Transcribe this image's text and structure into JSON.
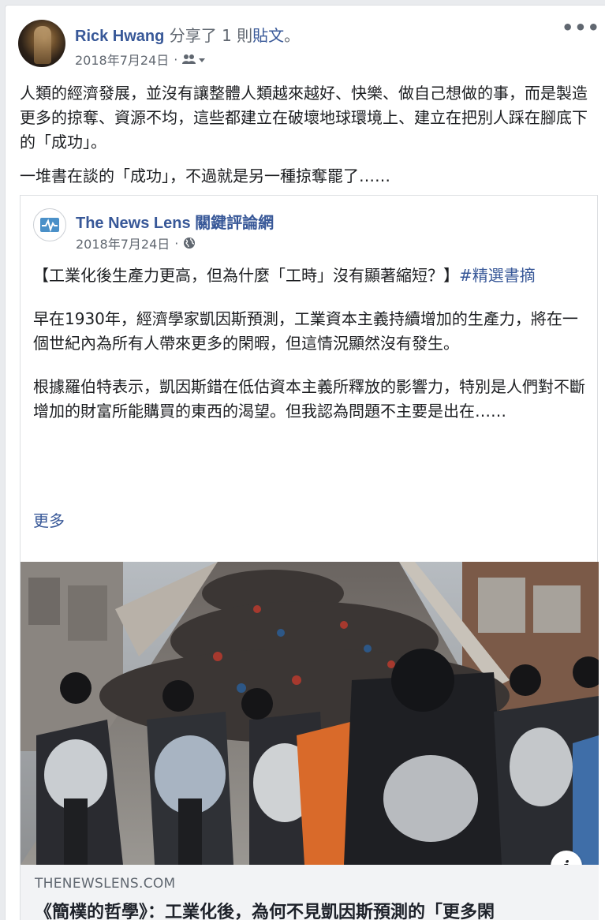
{
  "post": {
    "author": "Rick Hwang",
    "action": " 分享了 1 則",
    "shared_link": "貼文",
    "action_end": "。",
    "date": "2018年7月24日",
    "separator": "·",
    "audience_icon": "friends-icon",
    "more_label": "•••",
    "paragraphs": [
      "人類的經濟發展，並沒有讓整體人類越來越好、快樂、做自己想做的事，而是製造更多的掠奪、資源不均，這些都建立在破壞地球環境上、建立在把別人踩在腳底下的「成功」。",
      "一堆書在談的「成功」，不過就是另一種掠奪罷了……"
    ]
  },
  "shared": {
    "page_name": "The News Lens 關鍵評論網",
    "date": "2018年7月24日",
    "separator": "·",
    "audience_icon": "globe-icon",
    "headline": "【工業化後生產力更高，但為什麼「工時」沒有顯著縮短？】",
    "hashtag": "#精選書摘",
    "para1": "早在1930年，經濟學家凱因斯預測，工業資本主義持續增加的生產力，將在一個世紀內為所有人帶來更多的閑暇，但這情況顯然沒有發生。",
    "para2": "根據羅伯特表示，凱因斯錯在低估資本主義所釋放的影響力，特別是人們對不斷增加的財富所能購買的東西的渴望。但我認為問題不主要是出在……",
    "see_more": "更多",
    "info_label": "i",
    "link_domain": "THENEWSLENS.COM",
    "link_title": "《簡樸的哲學》：工業化後，為何不見凱因斯預測的「更多閑"
  },
  "colors": {
    "link": "#385898",
    "text": "#1c1e21",
    "meta": "#606770",
    "footer_bg": "#f2f3f5"
  }
}
